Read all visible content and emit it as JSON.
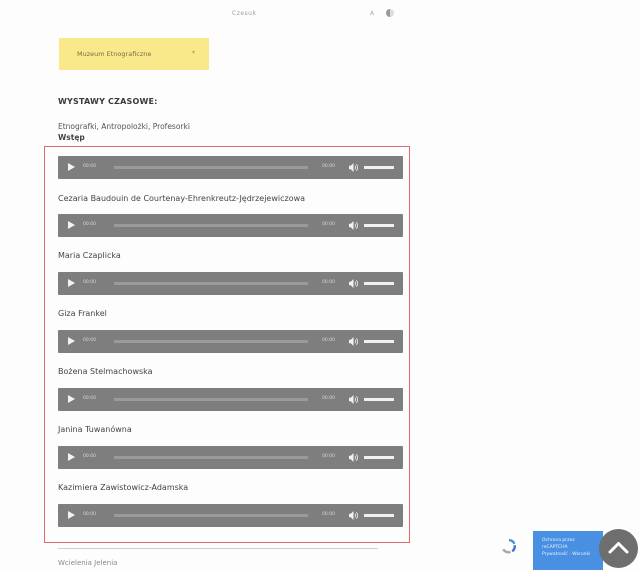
{
  "topbar": {
    "items": [
      "",
      "",
      "",
      "",
      "Czesuk",
      "",
      "",
      "",
      "",
      "",
      "A"
    ]
  },
  "nav": {
    "items": [
      "",
      "Muzeum Etnograficzne",
      "",
      ""
    ],
    "active_index": 1
  },
  "content": {
    "heading": "WYSTAWY CZASOWE:",
    "subline": "Etnografki, Antropolożki, Profesorki",
    "intro_label": "Wstęp",
    "players": [
      {
        "time_current": "00:00",
        "time_total": "00:00"
      },
      {
        "time_current": "00:00",
        "time_total": "00:00"
      },
      {
        "time_current": "00:00",
        "time_total": "00:00"
      },
      {
        "time_current": "00:00",
        "time_total": "00:00"
      },
      {
        "time_current": "00:00",
        "time_total": "00:00"
      },
      {
        "time_current": "00:00",
        "time_total": "00:00"
      },
      {
        "time_current": "00:00",
        "time_total": "00:00"
      }
    ],
    "names": [
      "Cezaria Baudouin de Courtenay-Ehrenkreutz-Jędrzejewiczowa",
      "Maria Czaplicka",
      "Giza Frankel",
      "Bożena Stelmachowska",
      "Janina Tuwanówna",
      "Kazimiera Zawistowicz-Adamska"
    ],
    "bottom_link": "Wcielenia Jelenia"
  },
  "recaptcha": {
    "line1": "Ochrona przez",
    "line2": "reCAPTCHA",
    "line3": "Prywatność · Warunki"
  },
  "colors": {
    "accent_yellow": "#f9e98a",
    "frame_red": "#e06a6a",
    "player_gray": "#7e7e7e",
    "recaptcha_blue": "#4a90e2"
  }
}
